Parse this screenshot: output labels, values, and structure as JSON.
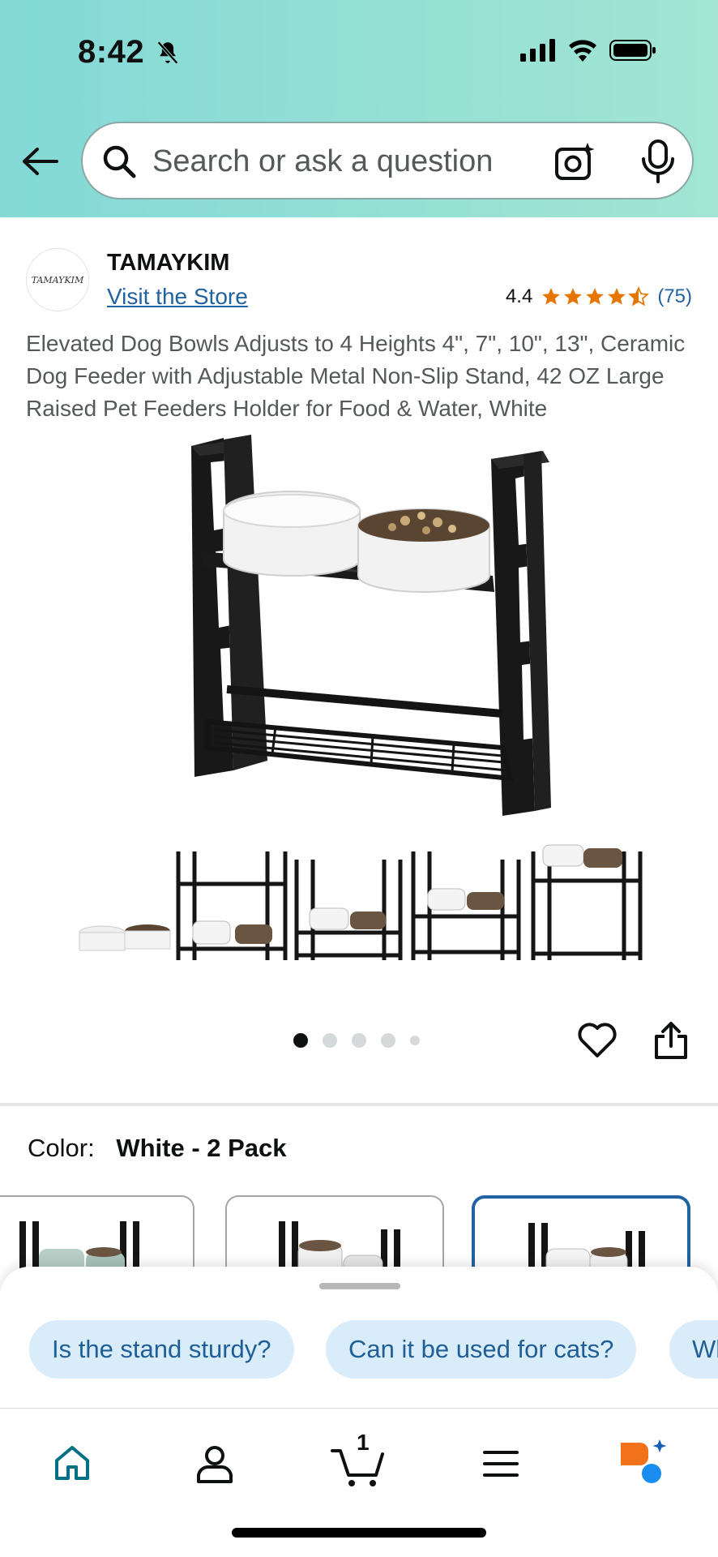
{
  "status_bar": {
    "time": "8:42"
  },
  "search": {
    "placeholder": "Search or ask a question"
  },
  "brand": {
    "logo_text": "TAMAYKIM",
    "name": "TAMAYKIM",
    "visit_store": "Visit the Store"
  },
  "rating": {
    "value": "4.4",
    "stars": 4.4,
    "count": "(75)"
  },
  "product": {
    "title": "Elevated Dog Bowls Adjusts to 4 Heights 4\", 7\", 10\", 13\", Ceramic Dog Feeder with Adjustable Metal Non-Slip Stand, 42 OZ Large Raised Pet Feeders Holder for Food & Water, White"
  },
  "carousel": {
    "image_count": 5,
    "active_index": 0
  },
  "color": {
    "label": "Color:",
    "value": "White - 2 Pack"
  },
  "suggestions": [
    "Is the stand sturdy?",
    "Can it be used for cats?",
    "Wh"
  ],
  "nav": {
    "items": [
      "home-icon",
      "account-icon",
      "cart-icon",
      "menu-icon",
      "rufus-icon"
    ],
    "cart_count": "1"
  },
  "colors": {
    "accent": "#2162a1",
    "star": "#e77600",
    "chip_bg": "#d9ecfa",
    "header": "#93dfd5"
  }
}
